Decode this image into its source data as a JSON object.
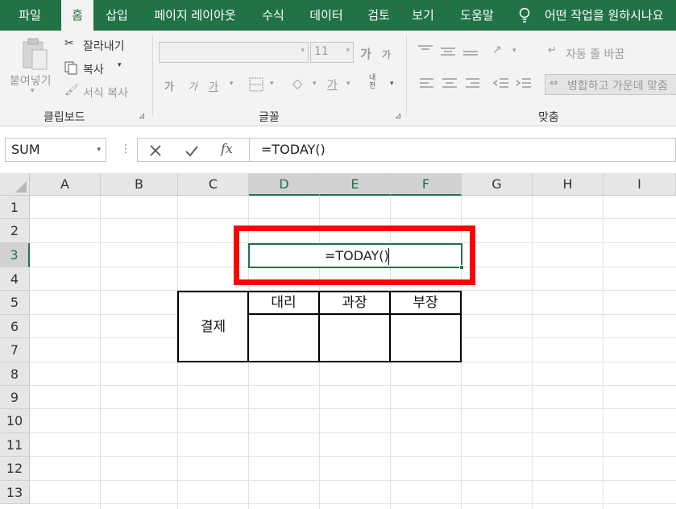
{
  "tabs": [
    "파일",
    "홈",
    "삽입",
    "페이지 레이아웃",
    "수식",
    "데이터",
    "검토",
    "보기",
    "도움말"
  ],
  "tell_me": "어떤 작업을 원하시나요",
  "clipboard": {
    "paste": "붙여넣기",
    "cut": "잘라내기",
    "copy": "복사",
    "format_painter": "서식 복사",
    "group": "클립보드"
  },
  "font": {
    "size": "11",
    "grow": "가",
    "shrink": "가",
    "bold": "가",
    "italic": "가",
    "underline": "가",
    "font_color": "가",
    "phonetic": "내천",
    "group": "글꼴"
  },
  "alignment": {
    "wrap_text": "자동 줄 바꿈",
    "merge_center": "병합하고 가운데 맞춤",
    "group": "맞춤"
  },
  "formula_bar": {
    "name_box": "SUM",
    "fx": "fx",
    "formula": "=TODAY()"
  },
  "columns": [
    "A",
    "B",
    "C",
    "D",
    "E",
    "F",
    "G",
    "H",
    "I"
  ],
  "rows": [
    "1",
    "2",
    "3",
    "4",
    "5",
    "6",
    "7",
    "8",
    "9",
    "10",
    "11",
    "12",
    "13"
  ],
  "active_cell": {
    "text": "=TODAY()"
  },
  "approval_table": {
    "title": "결제",
    "headers": [
      "대리",
      "과장",
      "부장"
    ]
  },
  "colors": {
    "excel_green": "#217346",
    "highlight_red": "#ff0000"
  }
}
